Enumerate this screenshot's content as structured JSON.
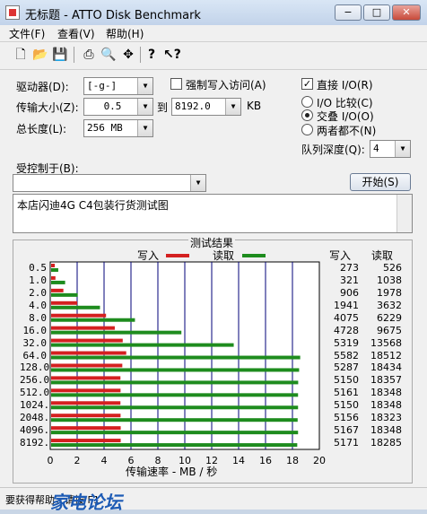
{
  "window": {
    "title": "无标题 - ATTO Disk Benchmark",
    "controls": [
      "−",
      "□",
      "✕"
    ]
  },
  "menu": [
    "文件(F)",
    "查看(V)",
    "帮助(H)"
  ],
  "toolbar": [
    "new-icon",
    "open-icon",
    "save-icon",
    "print-icon",
    "print-preview-icon",
    "move-icon",
    "help-icon",
    "context-help-icon"
  ],
  "settings": {
    "drive_label": "驱动器(D):",
    "drive_value": "[-g-]",
    "transfer_label": "传输大小(Z):",
    "transfer_from": "0.5",
    "transfer_to_label": "到",
    "transfer_to": "8192.0",
    "transfer_unit": "KB",
    "total_label": "总长度(L):",
    "total_value": "256 MB",
    "force_write_label": "强制写入访问(A)",
    "direct_io_label": "直接 I/O(R)",
    "io_compare_label": "I/O 比较(C)",
    "overlap_io_label": "交叠 I/O(O)",
    "neither_label": "两者都不(N)",
    "queue_label": "队列深度(Q):",
    "queue_value": "4",
    "controlled_label": "受控制于(B):",
    "controlled_value": "",
    "start_button": "开始(S)",
    "description": "本店闪迪4G C4包装行货测试图"
  },
  "results": {
    "title": "测试结果",
    "legend_write": "写入",
    "legend_read": "读取",
    "col_write": "写入",
    "col_read": "读取",
    "xlabel": "传输速率 - MB / 秒",
    "colors": {
      "write": "#d42020",
      "read": "#1e8c1e",
      "grid": "#00007a"
    }
  },
  "chart_data": {
    "type": "bar",
    "title": "测试结果",
    "xlabel": "传输速率 - MB / 秒",
    "ylabel": "",
    "xlim": [
      0,
      20
    ],
    "xticks": [
      0,
      2,
      4,
      6,
      8,
      10,
      12,
      14,
      16,
      18,
      20
    ],
    "categories": [
      "0.5",
      "1.0",
      "2.0",
      "4.0",
      "8.0",
      "16.0",
      "32.0",
      "64.0",
      "128.0",
      "256.0",
      "512.0",
      "1024.0",
      "2048.0",
      "4096.0",
      "8192.0"
    ],
    "series": [
      {
        "name": "写入",
        "values": [
          0.27,
          0.32,
          0.91,
          1.94,
          4.08,
          4.73,
          5.32,
          5.58,
          5.29,
          5.15,
          5.16,
          5.15,
          5.16,
          5.17,
          5.17
        ]
      },
      {
        "name": "读取",
        "values": [
          0.53,
          1.04,
          1.98,
          3.63,
          6.23,
          9.68,
          13.57,
          18.51,
          18.43,
          18.36,
          18.35,
          18.35,
          18.32,
          18.35,
          18.29
        ]
      }
    ],
    "write_kb": [
      "273",
      "321",
      "906",
      "1941",
      "4075",
      "4728",
      "5319",
      "5582",
      "5287",
      "5150",
      "5161",
      "5150",
      "5156",
      "5167",
      "5171"
    ],
    "read_kb": [
      "526",
      "1038",
      "1978",
      "3632",
      "6229",
      "9675",
      "13568",
      "18512",
      "18434",
      "18357",
      "18348",
      "18348",
      "18323",
      "18348",
      "18285"
    ]
  },
  "status": {
    "text": "要获得帮助，请按 F1",
    "watermark": "家电论坛"
  }
}
